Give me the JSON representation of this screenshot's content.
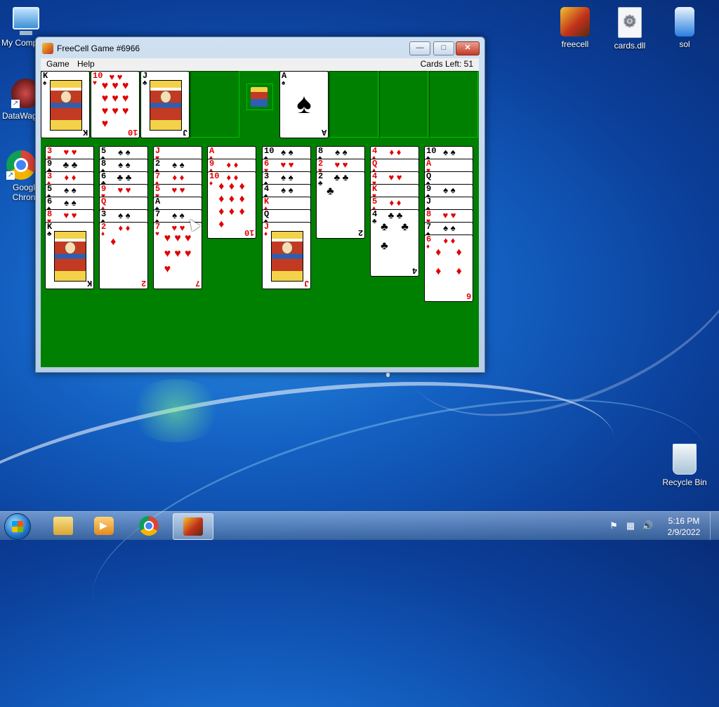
{
  "desktop": {
    "icons": [
      {
        "label": "My Comp"
      },
      {
        "label": "DataWag"
      },
      {
        "label": "Googl Chron"
      },
      {
        "label": "freecell"
      },
      {
        "label": "cards.dll"
      },
      {
        "label": "sol"
      },
      {
        "label": "Recycle Bin"
      }
    ]
  },
  "window": {
    "title": "FreeCell Game #6966",
    "buttons": {
      "minimize": "—",
      "maximize": "□",
      "close": "✕"
    },
    "menu": [
      "Game",
      "Help"
    ],
    "cards_left": "Cards Left: 51"
  },
  "free_cells": [
    {
      "rank": "K",
      "suit": "♠",
      "color": "black"
    },
    {
      "rank": "10",
      "suit": "♥",
      "color": "red"
    },
    {
      "rank": "J",
      "suit": "♣",
      "color": "black"
    },
    null
  ],
  "foundations": [
    {
      "rank": "A",
      "suit": "♠",
      "color": "black"
    },
    null,
    null,
    null
  ],
  "tableau": [
    [
      {
        "rank": "3",
        "suit": "♥",
        "color": "red"
      },
      {
        "rank": "9",
        "suit": "♣",
        "color": "black"
      },
      {
        "rank": "3",
        "suit": "♦",
        "color": "red"
      },
      {
        "rank": "5",
        "suit": "♠",
        "color": "black"
      },
      {
        "rank": "6",
        "suit": "♠",
        "color": "black"
      },
      {
        "rank": "8",
        "suit": "♥",
        "color": "red"
      },
      {
        "rank": "K",
        "suit": "♣",
        "color": "black"
      }
    ],
    [
      {
        "rank": "5",
        "suit": "♠",
        "color": "black"
      },
      {
        "rank": "8",
        "suit": "♠",
        "color": "black"
      },
      {
        "rank": "6",
        "suit": "♣",
        "color": "black"
      },
      {
        "rank": "9",
        "suit": "♥",
        "color": "red"
      },
      {
        "rank": "Q",
        "suit": "♦",
        "color": "red"
      },
      {
        "rank": "3",
        "suit": "♠",
        "color": "black"
      },
      {
        "rank": "2",
        "suit": "♦",
        "color": "red"
      }
    ],
    [
      {
        "rank": "J",
        "suit": "♥",
        "color": "red"
      },
      {
        "rank": "2",
        "suit": "♠",
        "color": "black"
      },
      {
        "rank": "7",
        "suit": "♦",
        "color": "red"
      },
      {
        "rank": "5",
        "suit": "♥",
        "color": "red"
      },
      {
        "rank": "A",
        "suit": "♠",
        "color": "black"
      },
      {
        "rank": "7",
        "suit": "♠",
        "color": "black"
      },
      {
        "rank": "7",
        "suit": "♥",
        "color": "red"
      }
    ],
    [
      {
        "rank": "A",
        "suit": "♦",
        "color": "red"
      },
      {
        "rank": "9",
        "suit": "♦",
        "color": "red"
      },
      {
        "rank": "10",
        "suit": "♦",
        "color": "red"
      }
    ],
    [
      {
        "rank": "10",
        "suit": "♠",
        "color": "black"
      },
      {
        "rank": "6",
        "suit": "♥",
        "color": "red"
      },
      {
        "rank": "3",
        "suit": "♠",
        "color": "black"
      },
      {
        "rank": "4",
        "suit": "♠",
        "color": "black"
      },
      {
        "rank": "K",
        "suit": "♦",
        "color": "red"
      },
      {
        "rank": "Q",
        "suit": "♠",
        "color": "black"
      },
      {
        "rank": "J",
        "suit": "♦",
        "color": "red"
      }
    ],
    [
      {
        "rank": "8",
        "suit": "♠",
        "color": "black"
      },
      {
        "rank": "2",
        "suit": "♥",
        "color": "red"
      },
      {
        "rank": "2",
        "suit": "♣",
        "color": "black"
      }
    ],
    [
      {
        "rank": "4",
        "suit": "♦",
        "color": "red"
      },
      {
        "rank": "Q",
        "suit": "♦",
        "color": "red"
      },
      {
        "rank": "4",
        "suit": "♥",
        "color": "red"
      },
      {
        "rank": "K",
        "suit": "♥",
        "color": "red"
      },
      {
        "rank": "5",
        "suit": "♦",
        "color": "red"
      },
      {
        "rank": "4",
        "suit": "♣",
        "color": "black"
      }
    ],
    [
      {
        "rank": "10",
        "suit": "♠",
        "color": "black"
      },
      {
        "rank": "A",
        "suit": "♥",
        "color": "red"
      },
      {
        "rank": "Q",
        "suit": "♠",
        "color": "black"
      },
      {
        "rank": "9",
        "suit": "♠",
        "color": "black"
      },
      {
        "rank": "J",
        "suit": "♠",
        "color": "black"
      },
      {
        "rank": "8",
        "suit": "♥",
        "color": "red"
      },
      {
        "rank": "7",
        "suit": "♠",
        "color": "black"
      },
      {
        "rank": "6",
        "suit": "♦",
        "color": "red"
      }
    ]
  ],
  "taskbar": {
    "pinned": [
      "windows-explorer",
      "media-player",
      "google-chrome",
      "freecell"
    ],
    "clock_time": "5:16 PM",
    "clock_date": "2/9/2022"
  },
  "colors": {
    "felt": "#008000",
    "red_suit": "#e00000",
    "black_suit": "#000000"
  }
}
